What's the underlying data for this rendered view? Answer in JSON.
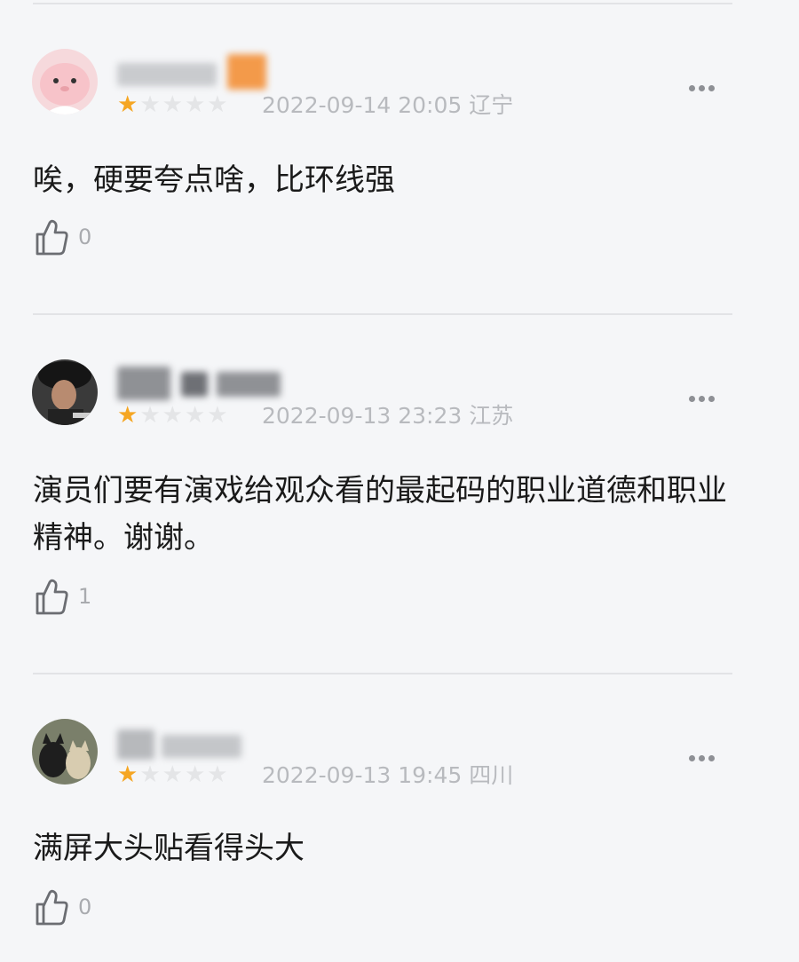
{
  "reviews": [
    {
      "rating": 1,
      "time": "2022-09-14 20:05",
      "location": "辽宁",
      "content": "唉，硬要夸点啥，比环线强",
      "likes": "0"
    },
    {
      "rating": 1,
      "time": "2022-09-13 23:23",
      "location": "江苏",
      "content": "演员们要有演戏给观众看的最起码的职业道德和职业精神。谢谢。",
      "likes": "1"
    },
    {
      "rating": 1,
      "time": "2022-09-13 19:45",
      "location": "四川",
      "content": "满屏大头贴看得头大",
      "likes": "0"
    }
  ],
  "icons": {
    "more": "more-icon",
    "like": "thumbs-up-icon",
    "star": "star-icon"
  },
  "colors": {
    "star_on": "#f5a623",
    "star_off": "#e4e5e7",
    "meta_text": "#b8babe"
  }
}
